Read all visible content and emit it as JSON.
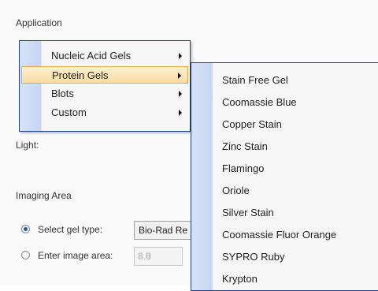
{
  "section_label": "Application",
  "light_label": "Light:",
  "imaging_area_label": "Imaging Area",
  "menu": {
    "items": [
      {
        "label": "Nucleic Acid Gels",
        "has_submenu": true,
        "selected": false
      },
      {
        "label": "Protein Gels",
        "has_submenu": true,
        "selected": true
      },
      {
        "label": "Blots",
        "has_submenu": true,
        "selected": false
      },
      {
        "label": "Custom",
        "has_submenu": true,
        "selected": false
      }
    ]
  },
  "submenu": {
    "items": [
      "Stain Free Gel",
      "Coomassie Blue",
      "Copper Stain",
      "Zinc Stain",
      "Flamingo",
      "Oriole",
      "Silver Stain",
      "Coomassie Fluor Orange",
      "SYPRO Ruby",
      "Krypton"
    ]
  },
  "options": {
    "select_gel_type": {
      "label": "Select gel type:",
      "value": "Bio-Rad Re",
      "checked": true
    },
    "enter_image_area": {
      "label": "Enter image area:",
      "value": "8.8",
      "checked": false
    }
  },
  "colors": {
    "menu_border": "#1f3f8f",
    "selection": "#f9dca0",
    "gutter": "#c6d6f2"
  }
}
